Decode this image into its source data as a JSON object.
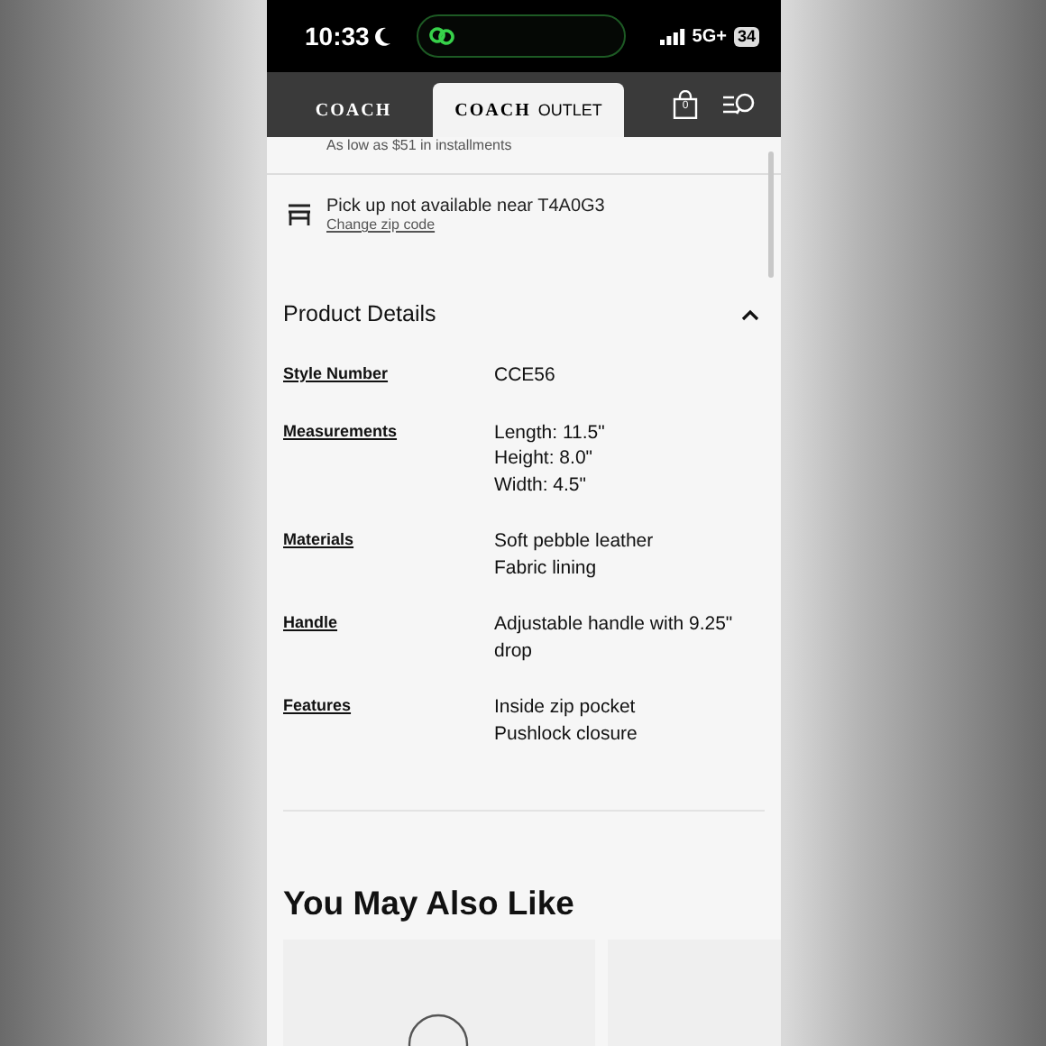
{
  "status_bar": {
    "time": "10:33",
    "network": "5G+",
    "battery": "34"
  },
  "nav": {
    "tabs": [
      {
        "logo": "COACH",
        "selected": false
      },
      {
        "logo": "COACH",
        "suffix": "OUTLET",
        "selected": true
      }
    ],
    "cart_count": "0"
  },
  "installments": "As low as $51 in installments",
  "pickup": {
    "message": "Pick up not available near T4A0G3",
    "link": "Change zip code"
  },
  "product_details": {
    "title": "Product Details",
    "expanded": true,
    "rows": [
      {
        "label": "Style Number",
        "lines": [
          "CCE56"
        ]
      },
      {
        "label": "Measurements",
        "lines": [
          "Length: 11.5\"",
          "Height: 8.0\"",
          "Width: 4.5\""
        ]
      },
      {
        "label": "Materials",
        "lines": [
          "Soft pebble leather",
          "Fabric lining"
        ]
      },
      {
        "label": "Handle",
        "lines": [
          "Adjustable handle with 9.25\" drop"
        ]
      },
      {
        "label": "Features",
        "lines": [
          "Inside zip pocket",
          "Pushlock closure"
        ]
      }
    ]
  },
  "recommendations": {
    "title": "You May Also Like"
  }
}
